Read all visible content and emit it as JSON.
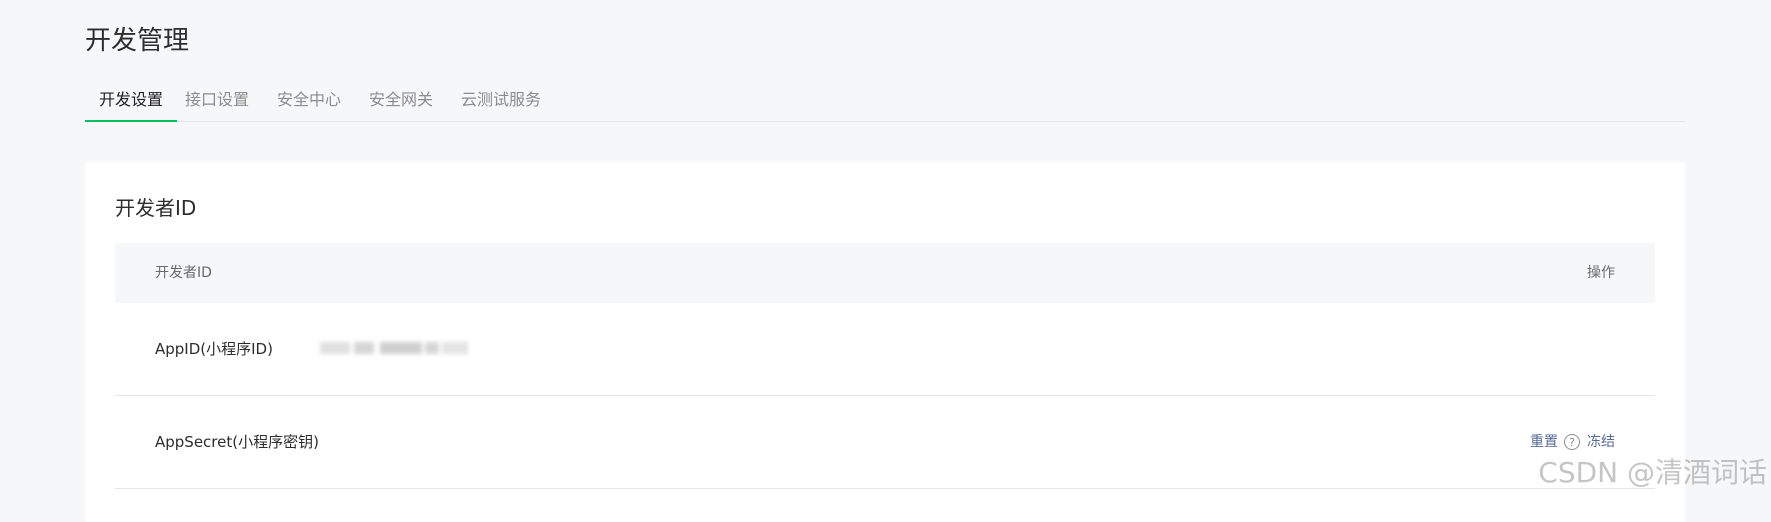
{
  "page": {
    "title": "开发管理"
  },
  "tabs": [
    {
      "label": "开发设置",
      "active": true
    },
    {
      "label": "接口设置",
      "active": false
    },
    {
      "label": "安全中心",
      "active": false
    },
    {
      "label": "安全网关",
      "active": false
    },
    {
      "label": "云测试服务",
      "active": false
    }
  ],
  "developer_id": {
    "section_title": "开发者ID",
    "columns": {
      "name": "开发者ID",
      "actions": "操作"
    },
    "rows": [
      {
        "label": "AppID(小程序ID)",
        "value_masked": true
      },
      {
        "label": "AppSecret(小程序密钥)",
        "actions": {
          "reset": "重置",
          "help": "?",
          "freeze": "冻结"
        }
      }
    ]
  },
  "watermark": "CSDN @清酒词话",
  "colors": {
    "accent": "#07c160",
    "link": "#576b95",
    "background": "#f6f7f9"
  }
}
